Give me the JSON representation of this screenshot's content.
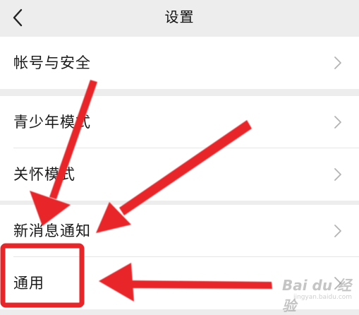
{
  "header": {
    "title": "设置",
    "back_icon": "chevron-left-icon"
  },
  "groups": [
    {
      "items": [
        {
          "label": "帐号与安全"
        }
      ]
    },
    {
      "items": [
        {
          "label": "青少年模式"
        },
        {
          "label": "关怀模式"
        }
      ]
    },
    {
      "items": [
        {
          "label": "新消息通知"
        },
        {
          "label": "通用"
        }
      ]
    }
  ],
  "annotation": {
    "arrow_color": "#e8262a",
    "highlight_color": "#e8262a",
    "highlighted_item": "通用"
  },
  "watermark": {
    "text": "Bai du 经验",
    "subtext": "jingyan.baidu.com"
  },
  "colors": {
    "background": "#ededed",
    "row_background": "#ffffff",
    "text": "#1a1a1a",
    "chevron": "#b3b3b3"
  }
}
